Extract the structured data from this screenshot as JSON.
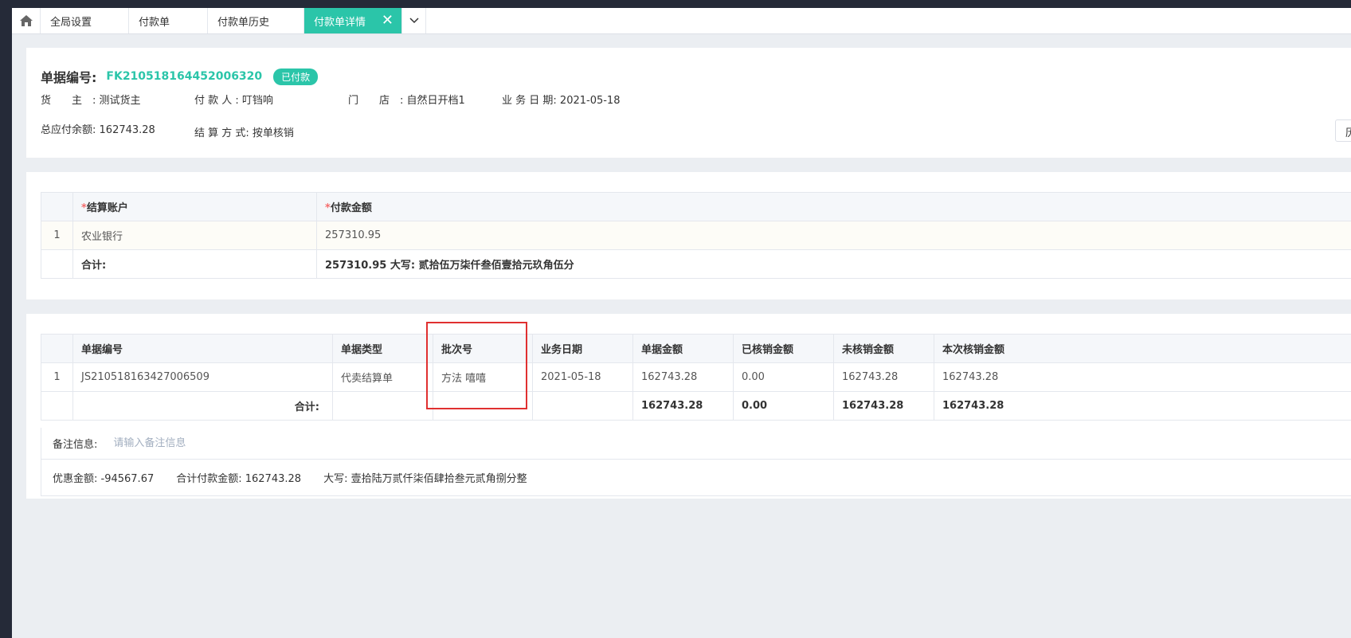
{
  "tabs": {
    "home_icon": "home-icon",
    "items": [
      "全局设置",
      "付款单",
      "付款单历史",
      "付款单详情"
    ],
    "close_glyph": "✕"
  },
  "header": {
    "doc_label": "单据编号:",
    "doc_no": "FK210518164452006320",
    "status": "已付款",
    "owner_label": "货　　主　:",
    "owner": "测试货主",
    "payer_label": "付 款 人 :",
    "payer": "叮铛响",
    "store_label": "门　　店　:",
    "store": "自然日开档1",
    "date_label": "业 务 日 期:",
    "date": "2021-05-18",
    "balance_label": "总应付余额:",
    "balance": "162743.28",
    "method_label": "结 算 方 式:",
    "method": "按单核销",
    "history_btn": "历"
  },
  "accounts": {
    "headers": [
      "结算账户",
      "付款金额"
    ],
    "rows": [
      {
        "idx": "1",
        "account": "农业银行",
        "amount": "257310.95"
      }
    ],
    "total_label": "合计:",
    "total_amount": "257310.95",
    "total_words": "大写: 贰拾伍万柒仟叁佰壹拾元玖角伍分"
  },
  "details": {
    "headers": [
      "单据编号",
      "单据类型",
      "批次号",
      "业务日期",
      "单据金额",
      "已核销金额",
      "未核销金额",
      "本次核销金额"
    ],
    "rows": [
      {
        "idx": "1",
        "doc_no": "JS210518163427006509",
        "type": "代卖结算单",
        "batch": "方法 嘻嘻",
        "date": "2021-05-18",
        "amount": "162743.28",
        "written_off": "0.00",
        "unwritten": "162743.28",
        "this_time": "162743.28"
      }
    ],
    "total_label": "合计:",
    "total_amount": "162743.28",
    "total_written_off": "0.00",
    "total_unwritten": "162743.28",
    "total_this_time": "162743.28"
  },
  "remark": {
    "label": "备注信息:",
    "placeholder": "请输入备注信息"
  },
  "summary": {
    "discount": "优惠金额: -94567.67",
    "total_pay": "合计付款金额: 162743.28",
    "words": "大写: 壹拾陆万贰仟柒佰肆拾叁元贰角捌分整"
  }
}
